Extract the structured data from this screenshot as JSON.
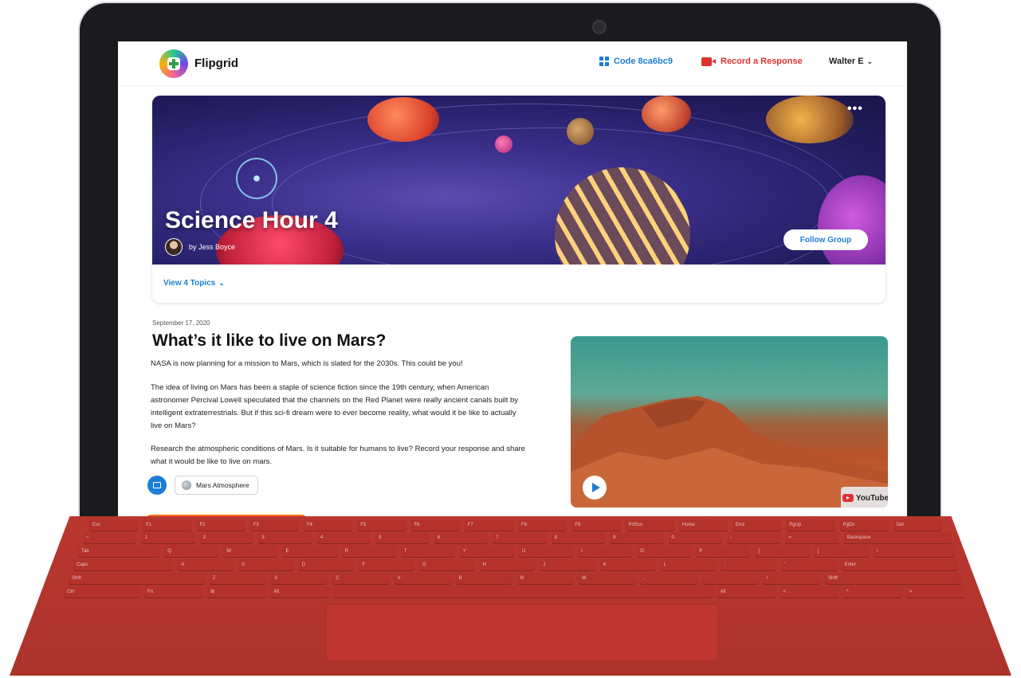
{
  "colors": {
    "accent": "#1c7ed6",
    "record": "#e03131",
    "keyboard": "#c33a32",
    "cta_orange": "#ff6b1a"
  },
  "nav": {
    "brand": "Flipgrid",
    "code_label": "Code 8ca6bc9",
    "record_label": "Record a Response",
    "user": "Walter E",
    "icons": {
      "logo": "flipgrid-logo",
      "code": "grid-icon",
      "record": "camera-icon",
      "user": "chevron-down-icon"
    }
  },
  "group": {
    "title": "Science Hour 4",
    "author": "by Jess Boyce",
    "follow_label": "Follow Group",
    "more_label": "•••",
    "topics_link": "View 4 Topics"
  },
  "topic": {
    "date": "September 17, 2020",
    "title": "What’s it like to live on Mars?",
    "intro": "NASA is now planning for a mission to Mars, which is slated for the 2030s. This could be you!",
    "body": "The idea of living on Mars has been a staple of science fiction since the 19th century, when American astronomer Percival Lowell speculated that the channels on the Red Planet were really ancient canals built by intelligent extraterrestrials. But if this sci-fi dream were to ever become reality, what would it be like to actually live on Mars?",
    "prompt": "Research the atmospheric conditions of Mars. Is it suitable for humans to live? Record your response and share what it would be like to live on mars.",
    "resource_chip": "Mars Atmosphere",
    "video_source": "YouTube"
  },
  "keyboard": {
    "fn_row": [
      "Esc",
      "F1",
      "F2",
      "F3",
      "F4",
      "F5",
      "F6",
      "F7",
      "F8",
      "F9",
      "PrtScn",
      "Home",
      "End",
      "PgUp",
      "PgDn",
      "Del"
    ],
    "row1": [
      "~",
      "1",
      "2",
      "3",
      "4",
      "5",
      "6",
      "7",
      "8",
      "9",
      "0",
      "-",
      "=",
      "Backspace"
    ],
    "row2": [
      "Tab",
      "Q",
      "W",
      "E",
      "R",
      "T",
      "Y",
      "U",
      "I",
      "O",
      "P",
      "[",
      "]",
      "\\"
    ],
    "row3": [
      "Caps",
      "A",
      "S",
      "D",
      "F",
      "G",
      "H",
      "J",
      "K",
      "L",
      ";",
      "'",
      "Enter"
    ],
    "row4": [
      "Shift",
      "Z",
      "X",
      "C",
      "V",
      "B",
      "N",
      "M",
      ",",
      ".",
      "/",
      "Shift"
    ],
    "row5": [
      "Ctrl",
      "Fn",
      "⊞",
      "Alt",
      "",
      "Alt",
      "<",
      "^",
      ">"
    ]
  }
}
